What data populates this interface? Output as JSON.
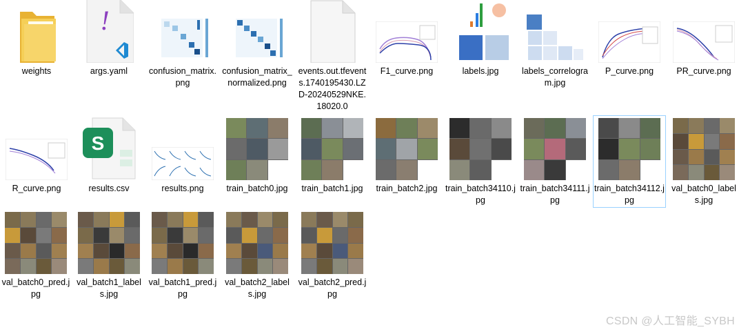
{
  "files": [
    {
      "name": "weights",
      "type": "folder-icon"
    },
    {
      "name": "args.yaml",
      "type": "yaml-file-icon"
    },
    {
      "name": "confusion_matrix.png",
      "type": "image-thumbnail"
    },
    {
      "name": "confusion_matrix_normalized.png",
      "type": "image-thumbnail"
    },
    {
      "name": "events.out.tfevents.1740195430.LZD-20240529NKE.18020.0",
      "type": "blank-file-icon"
    },
    {
      "name": "F1_curve.png",
      "type": "image-thumbnail"
    },
    {
      "name": "labels.jpg",
      "type": "image-thumbnail"
    },
    {
      "name": "labels_correlogram.jpg",
      "type": "image-thumbnail"
    },
    {
      "name": "P_curve.png",
      "type": "image-thumbnail"
    },
    {
      "name": "PR_curve.png",
      "type": "image-thumbnail"
    },
    {
      "name": "R_curve.png",
      "type": "image-thumbnail"
    },
    {
      "name": "results.csv",
      "type": "csv-file-icon"
    },
    {
      "name": "results.png",
      "type": "image-thumbnail"
    },
    {
      "name": "train_batch0.jpg",
      "type": "image-thumbnail"
    },
    {
      "name": "train_batch1.jpg",
      "type": "image-thumbnail"
    },
    {
      "name": "train_batch2.jpg",
      "type": "image-thumbnail"
    },
    {
      "name": "train_batch34110.jpg",
      "type": "image-thumbnail"
    },
    {
      "name": "train_batch34111.jpg",
      "type": "image-thumbnail"
    },
    {
      "name": "train_batch34112.jpg",
      "type": "image-thumbnail",
      "selected": true
    },
    {
      "name": "val_batch0_labels.jpg",
      "type": "image-thumbnail"
    },
    {
      "name": "val_batch0_pred.jpg",
      "type": "image-thumbnail"
    },
    {
      "name": "val_batch1_labels.jpg",
      "type": "image-thumbnail"
    },
    {
      "name": "val_batch1_pred.jpg",
      "type": "image-thumbnail"
    },
    {
      "name": "val_batch2_labels.jpg",
      "type": "image-thumbnail"
    },
    {
      "name": "val_batch2_pred.jpg",
      "type": "image-thumbnail"
    }
  ],
  "watermark": "CSDN @人工智能_SYBH",
  "colors": {
    "selection_border": "#99d1ff",
    "folder": "#f4c542",
    "yaml_accent": "#8c3fbf",
    "csv_green": "#1d8f5a"
  }
}
